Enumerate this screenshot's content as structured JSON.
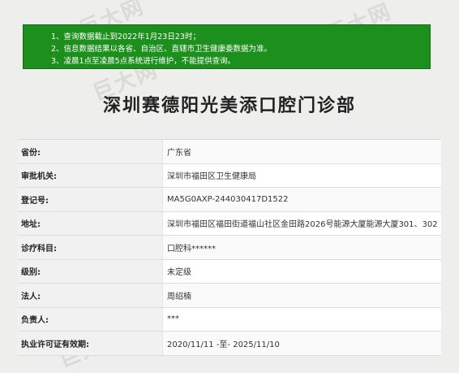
{
  "notice": {
    "lines": [
      "1、查询数据截止到2022年1月23日23时；",
      "2、信息数据结果以各省、自治区、直辖市卫生健康委数据为准。",
      "3、凌晨1点至凌晨5点系统进行维护，不能提供查询。"
    ]
  },
  "page_title": "深圳赛德阳光美添口腔门诊部",
  "rows": [
    {
      "label": "省份:",
      "value": "广东省"
    },
    {
      "label": "审批机关:",
      "value": "深圳市福田区卫生健康局"
    },
    {
      "label": "登记号:",
      "value": "MA5G0AXP-244030417D1522"
    },
    {
      "label": "地址:",
      "value": "深圳市福田区福田街道福山社区金田路2026号能源大厦能源大厦301、302"
    },
    {
      "label": "诊疗科目:",
      "value": "口腔科******"
    },
    {
      "label": "级别:",
      "value": "未定级"
    },
    {
      "label": "法人:",
      "value": "周绍楠"
    },
    {
      "label": "负责人:",
      "value": "***"
    },
    {
      "label": "执业许可证有效期:",
      "value": "2020/11/11 -至- 2025/11/10"
    }
  ],
  "watermark": {
    "text": "巨大网",
    "url": "www.cnjuda.com"
  }
}
